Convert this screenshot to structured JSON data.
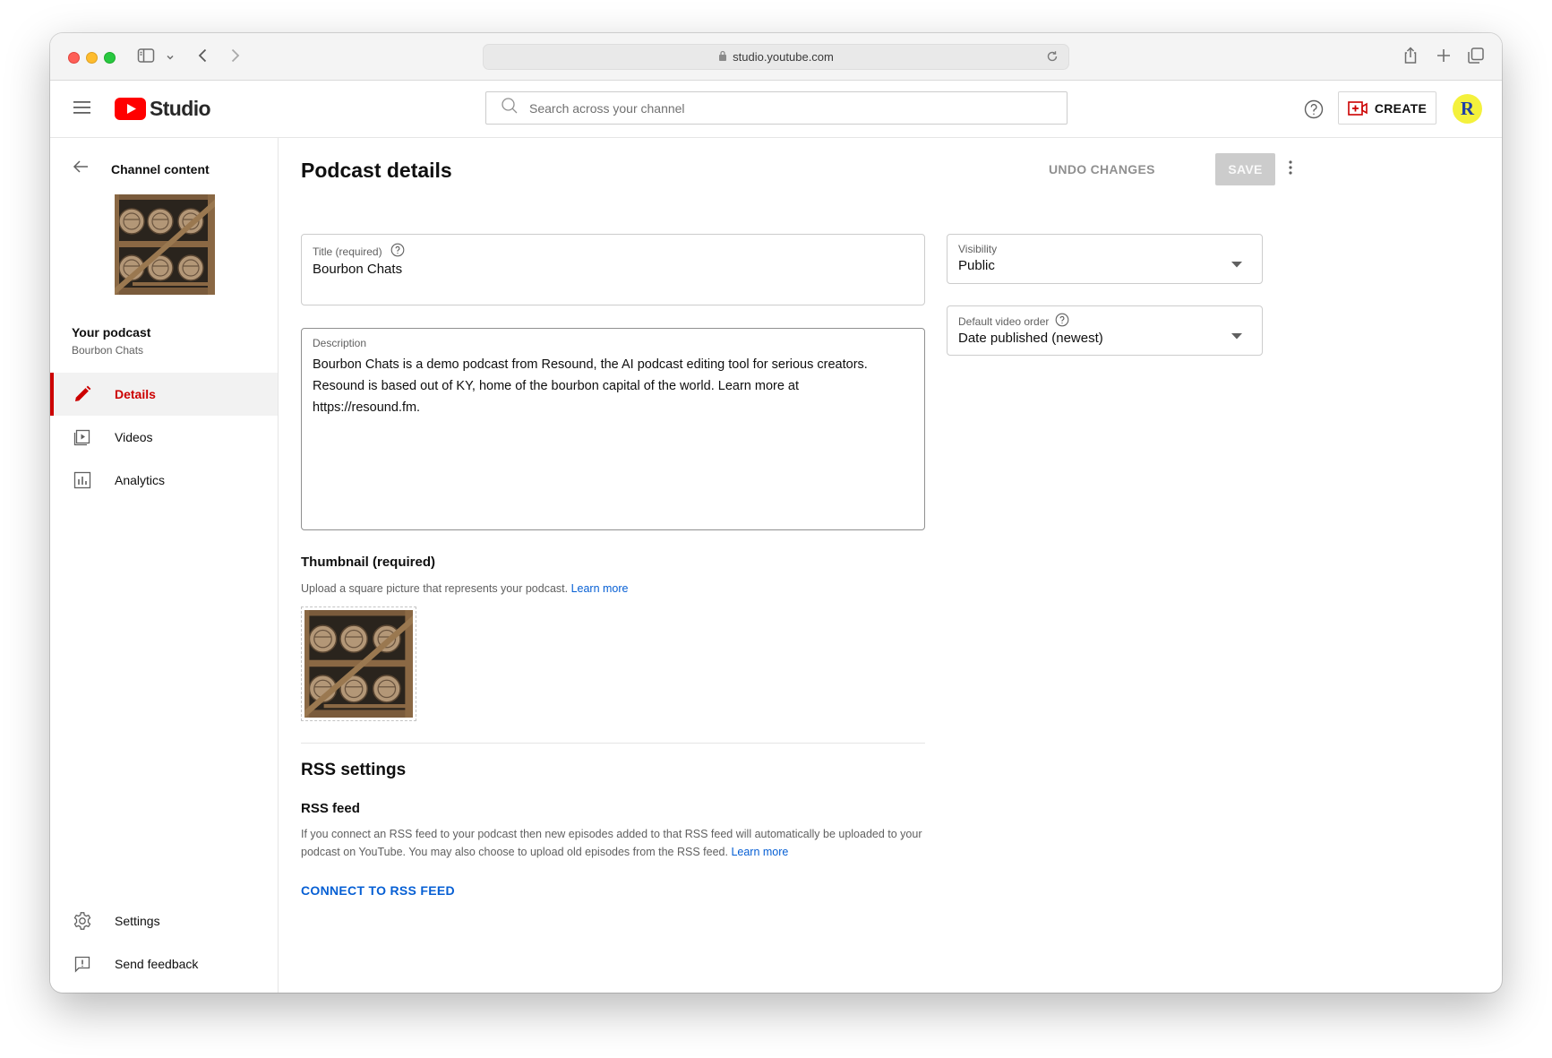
{
  "browser": {
    "url": "studio.youtube.com"
  },
  "header": {
    "logo_text": "Studio",
    "search_placeholder": "Search across your channel",
    "create_label": "CREATE",
    "avatar_letter": "R"
  },
  "sidebar": {
    "back_label": "Channel content",
    "podcast_heading": "Your podcast",
    "podcast_name": "Bourbon Chats",
    "nav": [
      {
        "label": "Details",
        "icon": "pencil-icon",
        "active": true
      },
      {
        "label": "Videos",
        "icon": "video-icon",
        "active": false
      },
      {
        "label": "Analytics",
        "icon": "analytics-icon",
        "active": false
      }
    ],
    "footer": [
      {
        "label": "Settings",
        "icon": "gear-icon"
      },
      {
        "label": "Send feedback",
        "icon": "feedback-icon"
      }
    ]
  },
  "main": {
    "title": "Podcast details",
    "undo_label": "UNDO CHANGES",
    "save_label": "SAVE",
    "title_field": {
      "label": "Title (required)",
      "value": "Bourbon Chats"
    },
    "description_field": {
      "label": "Description",
      "value": "Bourbon Chats is a demo podcast from Resound, the AI podcast editing tool for serious creators. Resound is based out of KY, home of the bourbon capital of the world. Learn more at https://resound.fm."
    },
    "visibility": {
      "label": "Visibility",
      "value": "Public"
    },
    "video_order": {
      "label": "Default video order",
      "value": "Date published (newest)"
    },
    "thumbnail": {
      "heading": "Thumbnail (required)",
      "help_text": "Upload a square picture that represents your podcast.",
      "learn_more": "Learn more"
    },
    "rss": {
      "heading": "RSS settings",
      "subheading": "RSS feed",
      "help_text": "If you connect an RSS feed to your podcast then new episodes added to that RSS feed will automatically be uploaded to your podcast on YouTube. You may also choose to upload old episodes from the RSS feed.",
      "learn_more": "Learn more",
      "connect_label": "CONNECT TO RSS FEED"
    }
  },
  "colors": {
    "accent_red": "#cc0000",
    "link_blue": "#065fd4",
    "avatar_bg": "#f4f13c"
  }
}
